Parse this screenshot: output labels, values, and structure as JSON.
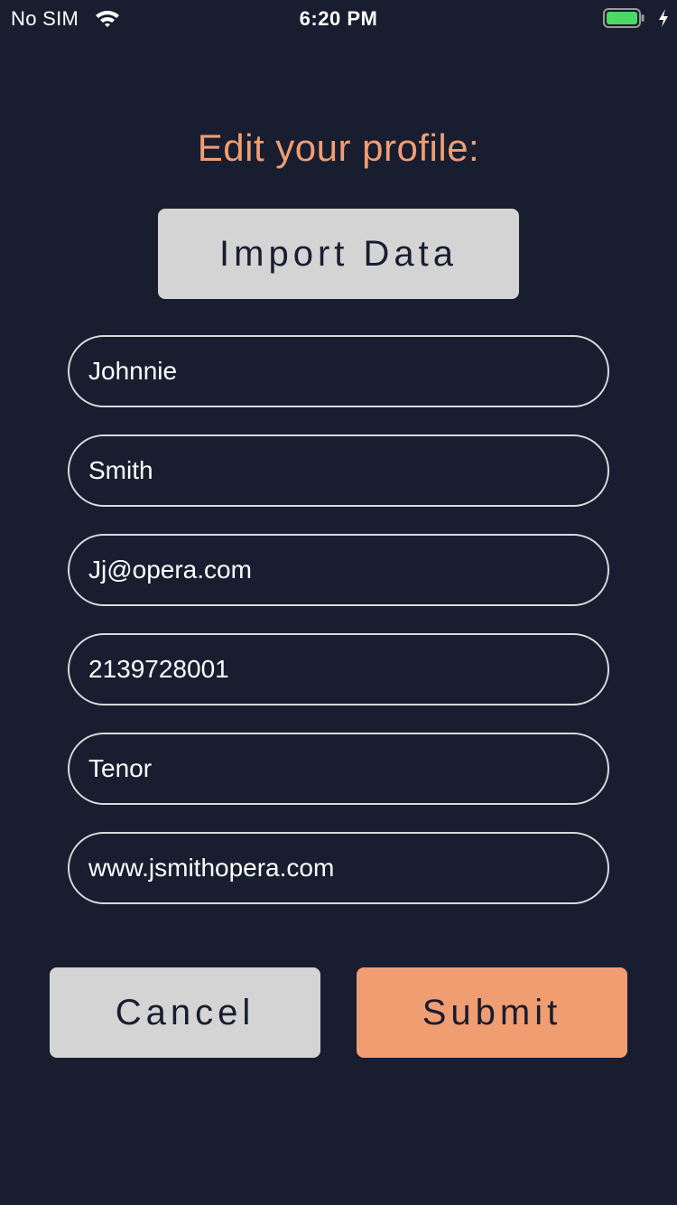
{
  "status_bar": {
    "carrier": "No SIM",
    "time": "6:20 PM",
    "wifi_icon": "wifi-icon",
    "battery_icon": "battery-icon",
    "charging_icon": "charging-bolt-icon",
    "battery_color": "#4cd964"
  },
  "form": {
    "title": "Edit your profile:",
    "import_label": "Import Data",
    "fields": [
      {
        "name": "first-name",
        "value": "Johnnie"
      },
      {
        "name": "last-name",
        "value": "Smith"
      },
      {
        "name": "email",
        "value": "Jj@opera.com"
      },
      {
        "name": "phone",
        "value": "2139728001"
      },
      {
        "name": "voice-type",
        "value": "Tenor"
      },
      {
        "name": "website",
        "value": "www.jsmithopera.com"
      }
    ],
    "cancel_label": "Cancel",
    "submit_label": "Submit"
  },
  "colors": {
    "background": "#181d30",
    "accent": "#f09d72",
    "button_gray": "#d4d4d4",
    "field_border": "#d9d9d9"
  }
}
